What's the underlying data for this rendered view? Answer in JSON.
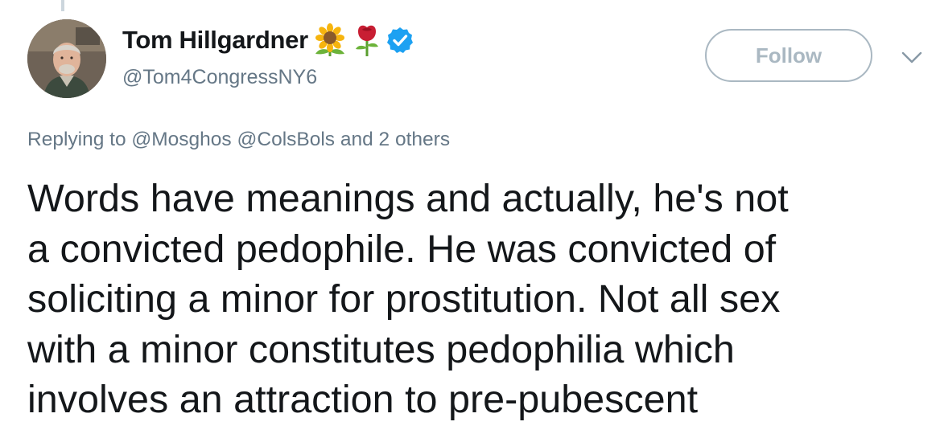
{
  "tweet": {
    "author": {
      "display_name": "Tom Hillgardner",
      "handle": "@Tom4CongressNY6",
      "name_emojis": [
        "sunflower-emoji",
        "rose-emoji"
      ],
      "verified": true
    },
    "follow_label": "Follow",
    "reply_context": {
      "prefix": "Replying to",
      "mentions": [
        "@Mosghos",
        "@ColsBols"
      ],
      "suffix": "and 2 others"
    },
    "text_lines": [
      "Words have meanings and actually, he's not",
      "a convicted pedophile. He was convicted of",
      "soliciting a minor for prostitution. Not all sex",
      "with a minor constitutes pedophilia which",
      "involves an attraction to pre-pubescent"
    ]
  },
  "colors": {
    "text_primary": "#14171a",
    "text_secondary": "#657786",
    "verified_blue": "#1da1f2",
    "follow_border": "#aab8c2",
    "thread_line": "#ccd6dd"
  },
  "icons": {
    "verified": "verified-badge-icon",
    "more": "chevron-down-icon"
  }
}
